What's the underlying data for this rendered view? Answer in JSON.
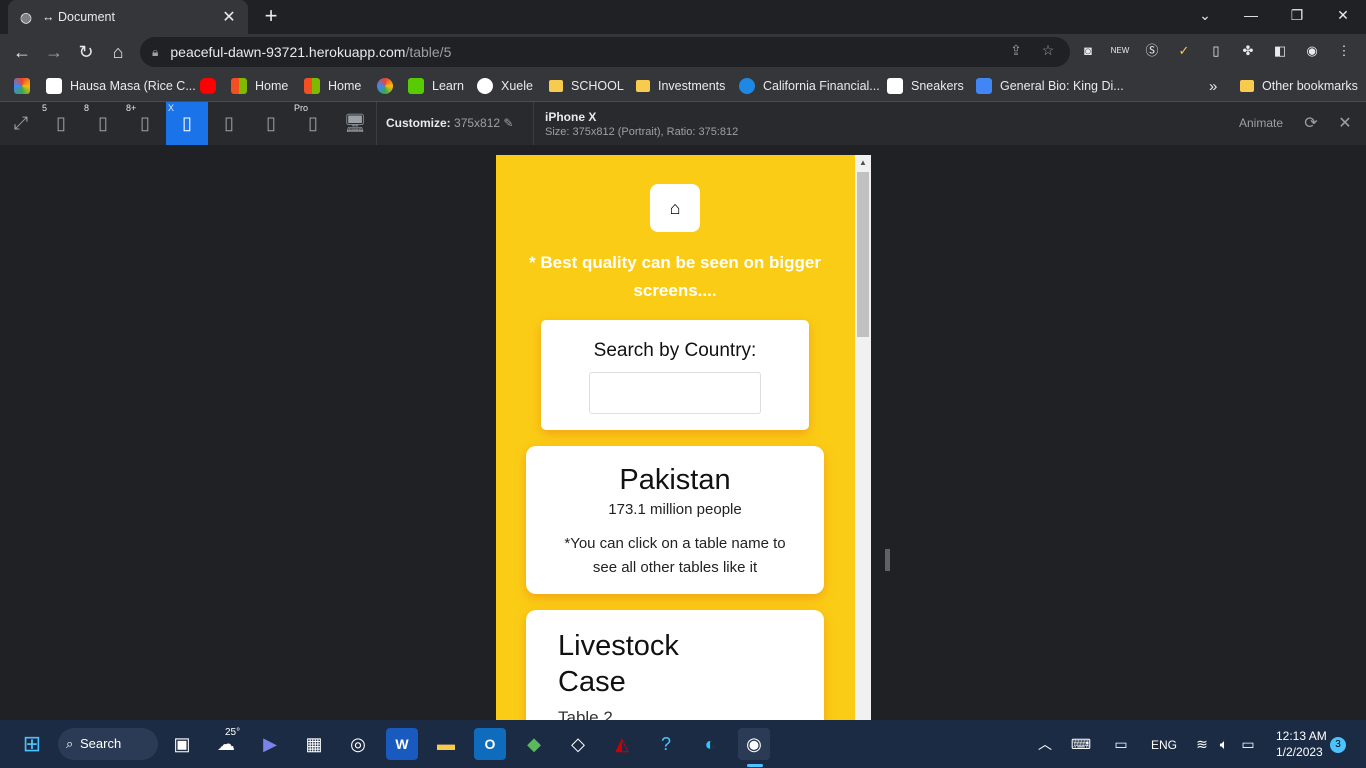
{
  "browser": {
    "tab_title": "↔ Document",
    "url_domain": "peaceful-dawn-93721.herokuapp.com",
    "url_path": "/table/5"
  },
  "bookmarks": [
    {
      "label": "Hausa Masa (Rice C...",
      "icon_color": "#ffffff"
    },
    {
      "label": "",
      "icon_color": "#ff0000"
    },
    {
      "label": "Home",
      "icon_color": "#f25022"
    },
    {
      "label": "Home",
      "icon_color": "#f25022"
    },
    {
      "label": "",
      "icon_color": "#4285f4"
    },
    {
      "label": "Learn",
      "icon_color": "#58cc02"
    },
    {
      "label": "Xuele",
      "icon_color": "#ffffff"
    },
    {
      "label": "SCHOOL",
      "icon_color": "#f7cb4d"
    },
    {
      "label": "Investments",
      "icon_color": "#f7cb4d"
    },
    {
      "label": "California Financial...",
      "icon_color": "#1e88e5"
    },
    {
      "label": "Sneakers",
      "icon_color": "#ffffff"
    },
    {
      "label": "General Bio: King Di...",
      "icon_color": "#4285f4"
    }
  ],
  "bookmarks_overflow": "»",
  "other_bookmarks": "Other bookmarks",
  "device_toolbar": {
    "device_labels": [
      "5",
      "8",
      "8+",
      "X",
      "Pro"
    ],
    "customize_label": "Customize:",
    "customize_value": "375x812",
    "device_name": "iPhone X",
    "device_size": "Size: 375x812 (Portrait), Ratio: 375:812",
    "animate_label": "Animate"
  },
  "page": {
    "notice": "* Best quality can be seen on bigger screens....",
    "search_label": "Search by Country:",
    "search_value": "",
    "country_name": "Pakistan",
    "population": "173.1 million people",
    "hint": "*You can click on a table name to see all other tables like it",
    "table_name": "Livestock Case",
    "table_sub": "Table 2",
    "bg_color": "#facc15"
  },
  "taskbar": {
    "search_label": "Search",
    "weather_temp": "25°",
    "language": "ENG",
    "time": "12:13 AM",
    "date": "1/2/2023",
    "notifications": "3"
  }
}
